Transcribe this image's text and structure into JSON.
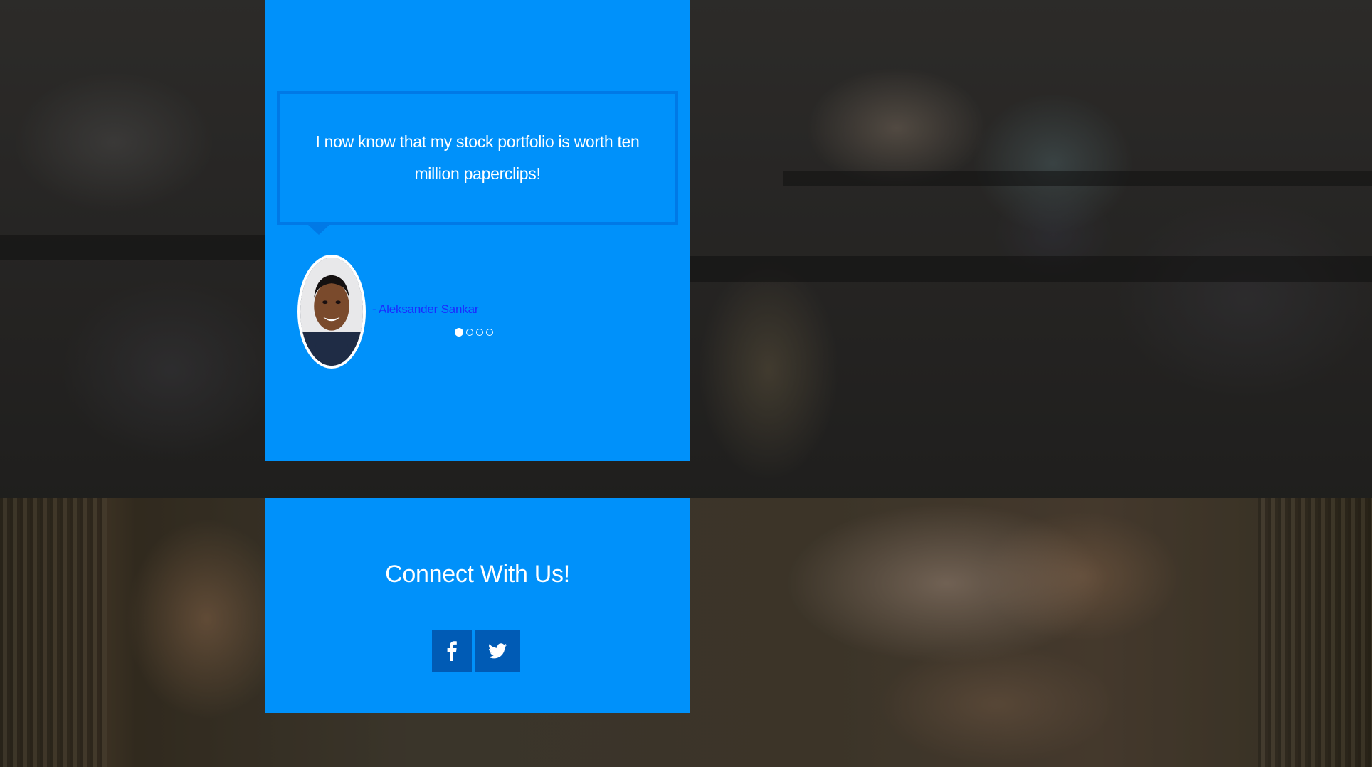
{
  "testimonial": {
    "quote": "I now know that my stock portfolio is worth ten million paperclips!",
    "author": "- Aleksander Sankar",
    "carousel": {
      "total_slides": 4,
      "active_index": 0
    }
  },
  "connect": {
    "title": "Connect With Us!",
    "social": [
      {
        "name": "facebook",
        "icon": "facebook-icon"
      },
      {
        "name": "twitter",
        "icon": "twitter-icon"
      }
    ]
  },
  "colors": {
    "panel": "#0091fa",
    "quote_border": "#0079e6",
    "social_button": "#005bb5",
    "author_text": "#1a2cff"
  }
}
